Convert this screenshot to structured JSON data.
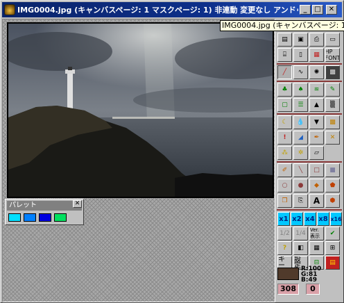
{
  "window": {
    "title": "IMG0004.jpg (キャンバスページ: 1 マスクページ: 1)  非連動 変更なし アンドゥ 500kb 初期...",
    "tooltip": "IMG0004.jpg (キャンバスページ: 1 マスクペ",
    "minimize_label": "_",
    "maximize_label": "□",
    "close_label": "✕"
  },
  "palette": {
    "title": "パレット",
    "close_label": "✕",
    "swatches": [
      "#00e0ff",
      "#0080ff",
      "#0000e0",
      "#00e060",
      "#00ff00"
    ]
  },
  "toolbar": {
    "hp_font": "HP FONT",
    "zoom": [
      "x1",
      "x2",
      "x4",
      "x8",
      "x16"
    ],
    "zoom_small": [
      "1/2",
      "1/4"
    ],
    "ver_label": "Ver.表示",
    "key_label": "キー",
    "settings_label": "設定",
    "rgb": {
      "r": "R:100",
      "g": "G:81",
      "b": "B:49"
    },
    "current_color": "#503a2b",
    "stat_left": "308",
    "stat_right": "0"
  }
}
